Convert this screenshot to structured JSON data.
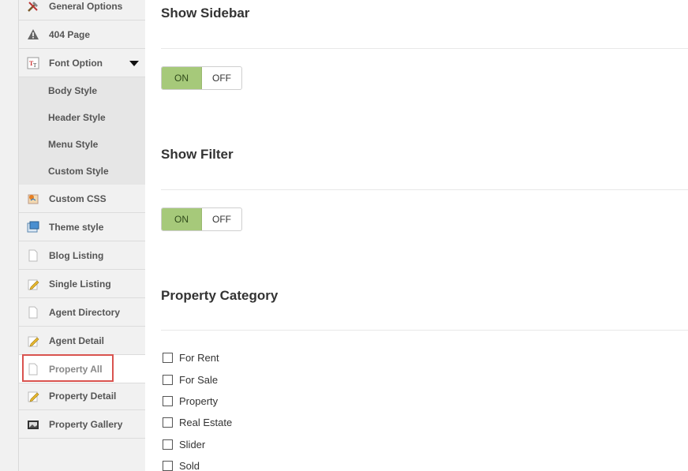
{
  "sidebar": {
    "items": [
      {
        "label": "General Options",
        "icon": "tools-icon"
      },
      {
        "label": "404 Page",
        "icon": "warning-icon"
      },
      {
        "label": "Font Option",
        "icon": "font-icon"
      },
      {
        "label": "Custom CSS",
        "icon": "css-icon"
      },
      {
        "label": "Theme style",
        "icon": "theme-icon"
      },
      {
        "label": "Blog Listing",
        "icon": "page-icon"
      },
      {
        "label": "Single Listing",
        "icon": "edit-icon"
      },
      {
        "label": "Agent Directory",
        "icon": "page-icon"
      },
      {
        "label": "Agent Detail",
        "icon": "edit-icon"
      },
      {
        "label": "Property All",
        "icon": "page-icon"
      },
      {
        "label": "Property Detail",
        "icon": "edit-icon"
      },
      {
        "label": "Property Gallery",
        "icon": "gallery-icon"
      }
    ],
    "font_subitems": [
      "Body Style",
      "Header Style",
      "Menu Style",
      "Custom Style"
    ],
    "active_item": "Property All"
  },
  "main": {
    "show_sidebar": {
      "title": "Show Sidebar",
      "on_label": "ON",
      "off_label": "OFF",
      "value": "ON"
    },
    "show_filter": {
      "title": "Show Filter",
      "on_label": "ON",
      "off_label": "OFF",
      "value": "ON"
    },
    "property_category": {
      "title": "Property Category",
      "options": [
        "For Rent",
        "For Sale",
        "Property",
        "Real Estate",
        "Slider",
        "Sold"
      ]
    }
  },
  "colors": {
    "toggle_on": "#a6c97a",
    "highlight": "#d9534f",
    "sidebar_bg": "#f1f1f1"
  }
}
